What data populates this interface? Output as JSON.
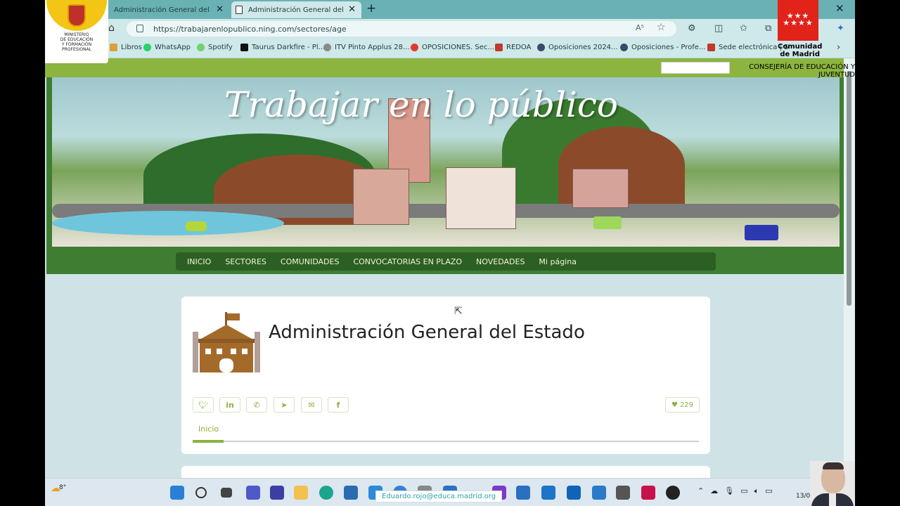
{
  "browser": {
    "tabs": [
      {
        "title": "Administración General del Estado"
      },
      {
        "title": "Administración General del Estado"
      }
    ],
    "url": "https://trabajarenlopublico.ning.com/sectores/age",
    "read_aloud_label": "A⁵"
  },
  "bookmarks": [
    {
      "label": "Libros",
      "color": "#d9a13a"
    },
    {
      "label": "WhatsApp",
      "color": "#25d366"
    },
    {
      "label": "Spotify",
      "color": "#6fd16f"
    },
    {
      "label": "Taurus Darkfire - Pl...",
      "color": "#111111"
    },
    {
      "label": "ITV Pinto Applus 28...",
      "color": "#8a8a8a"
    },
    {
      "label": "OPOSICIONES. Sec...",
      "color": "#e03a2c"
    },
    {
      "label": "REDOA",
      "color": "#c0392b"
    },
    {
      "label": "Oposiciones 2024...",
      "color": "#3a4a6a"
    },
    {
      "label": "Oposiciones - Profe...",
      "color": "#3a4a6a"
    },
    {
      "label": "Sede electrónica | S",
      "color": "#c0392b"
    }
  ],
  "logos": {
    "ministry": [
      "MINISTERIO",
      "DE EDUCACIÓN",
      "Y FORMACIÓN",
      "PROFESIONAL"
    ],
    "community_stars": "★★★\n★★★★",
    "community_name": "Comunidad de Madrid",
    "department": "CONSEJERÍA DE EDUCACIÓN Y JUVENTUD"
  },
  "site": {
    "hero_title": "Trabajar en lo público",
    "nav": [
      "INICIO",
      "SECTORES",
      "COMUNIDADES",
      "CONVOCATORIAS EN PLAZO",
      "NOVEDADES",
      "Mi página"
    ]
  },
  "card": {
    "title": "Administración General del Estado",
    "likes": "229",
    "tab": "Inicio"
  },
  "taskbar": {
    "weather": "8°",
    "email": "Eduardo.rojo@educa.madrid.org",
    "clock": "13/0"
  },
  "colors": {
    "brand_green": "#8bb13d",
    "nav_green": "#2c5f24",
    "banner_green": "#3f7d32",
    "madrid_red": "#e2231a"
  }
}
